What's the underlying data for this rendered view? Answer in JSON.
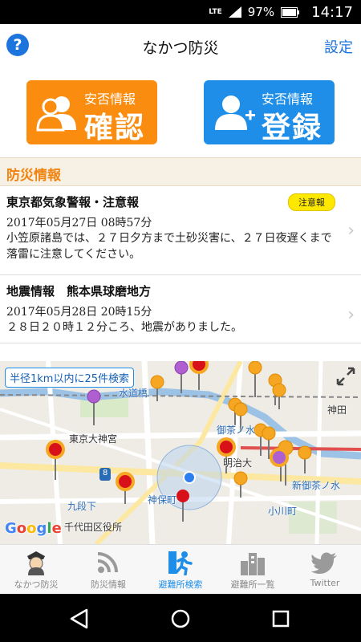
{
  "status_bar": {
    "network": "LTE",
    "battery": "97%",
    "time": "14:17"
  },
  "header": {
    "help_label": "?",
    "title": "なかつ防災",
    "settings_label": "設定"
  },
  "actions": {
    "confirm": {
      "small": "安否情報",
      "big": "確認",
      "color": "#fa8c10",
      "icon": "people-icon"
    },
    "register": {
      "small": "安否情報",
      "big": "登録",
      "color": "#1e8ee8",
      "icon": "add-person-icon"
    }
  },
  "news_section": {
    "title": "防災情報",
    "items": [
      {
        "title": "東京都気象警報・注意報",
        "badge": "注意報",
        "date": "2017年05月27日 08時57分",
        "body": "小笠原諸島では、２７日夕方まで土砂災害に、２７日夜遅くまで落雷に注意してください。"
      },
      {
        "title": "地震情報　熊本県球磨地方",
        "date": "2017年05月28日 20時15分",
        "body": "２８日２０時１２分ころ、地震がありました。"
      }
    ]
  },
  "map": {
    "search_label": "半径1km以内に25件検索",
    "places": [
      "水道橋",
      "東京大神宮",
      "御茶ノ水",
      "明治大",
      "九段下",
      "神保町",
      "千代田区役所",
      "新御茶ノ水",
      "小川町",
      "神田"
    ],
    "route_number": "8",
    "logo": "Google"
  },
  "tabs": [
    {
      "label": "なかつ防災",
      "icon": "mascot-icon",
      "active": false
    },
    {
      "label": "防災情報",
      "icon": "rss-icon",
      "active": false
    },
    {
      "label": "避難所検索",
      "icon": "evacuation-runner-icon",
      "active": true
    },
    {
      "label": "避難所一覧",
      "icon": "buildings-icon",
      "active": false
    },
    {
      "label": "Twitter",
      "icon": "twitter-bird-icon",
      "active": false
    }
  ],
  "colors": {
    "accent_orange": "#f08410",
    "accent_blue": "#1e8ee8",
    "badge_yellow": "#ffe800"
  }
}
